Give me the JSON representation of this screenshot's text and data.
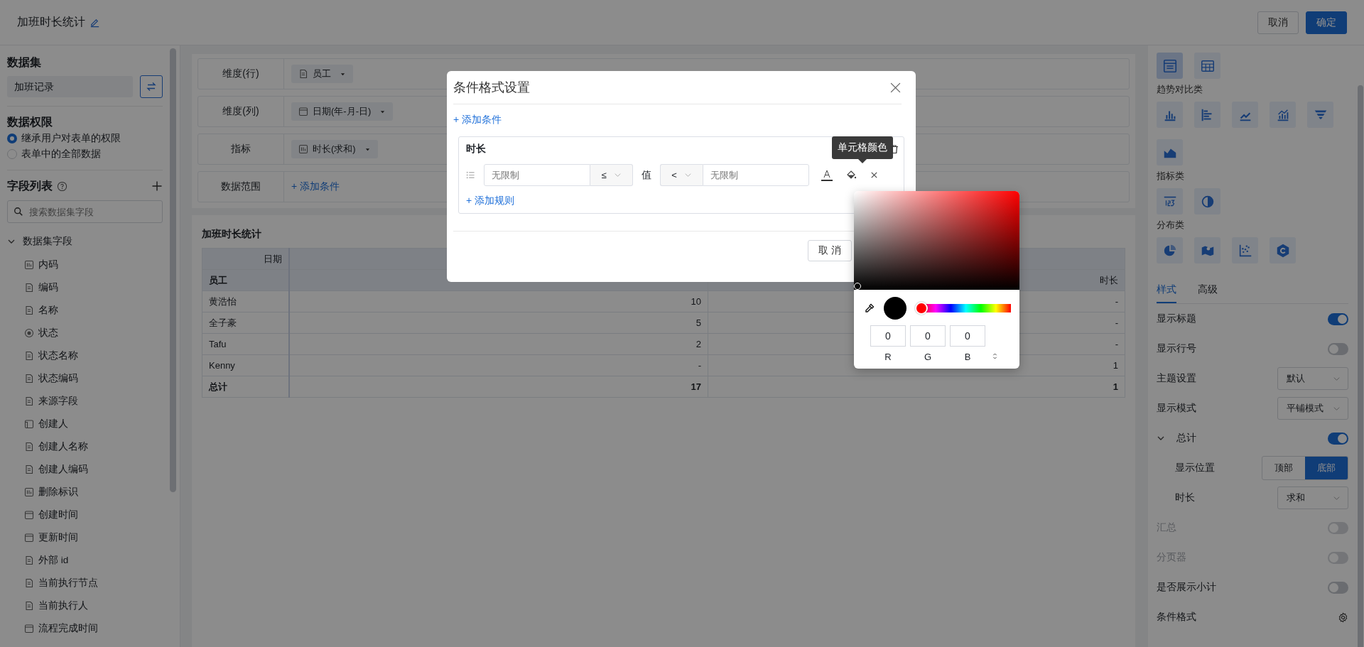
{
  "header": {
    "title": "加班时长统计",
    "buttons": [
      {
        "label": "取消",
        "kind": "default"
      },
      {
        "label": "确定",
        "kind": "primary"
      }
    ]
  },
  "sidebar": {
    "dataset_heading": "数据集",
    "dataset": "加班记录",
    "permission_heading": "数据权限",
    "permissions": [
      {
        "label": "继承用户对表单的权限",
        "selected": true
      },
      {
        "label": "表单中的全部数据",
        "selected": false
      }
    ],
    "fields_heading": "字段列表",
    "search": {
      "placeholder": "搜索数据集字段"
    },
    "tree": {
      "label": "数据集字段",
      "expanded": true,
      "children": [
        {
          "label": "内码",
          "kind": "number"
        },
        {
          "label": "编码",
          "kind": "text"
        },
        {
          "label": "名称",
          "kind": "text"
        },
        {
          "label": "状态",
          "kind": "option"
        },
        {
          "label": "状态名称",
          "kind": "text"
        },
        {
          "label": "状态编码",
          "kind": "text"
        },
        {
          "label": "来源字段",
          "kind": "text"
        },
        {
          "label": "创建人",
          "kind": "member"
        },
        {
          "label": "创建人名称",
          "kind": "text"
        },
        {
          "label": "创建人编码",
          "kind": "text"
        },
        {
          "label": "删除标识",
          "kind": "number"
        },
        {
          "label": "创建时间",
          "kind": "date"
        },
        {
          "label": "更新时间",
          "kind": "date"
        },
        {
          "label": "外部 id",
          "kind": "text"
        },
        {
          "label": "当前执行节点",
          "kind": "text"
        },
        {
          "label": "当前执行人",
          "kind": "text"
        },
        {
          "label": "流程完成时间",
          "kind": "date"
        }
      ]
    }
  },
  "config": [
    {
      "label": "维度(行)",
      "chip": {
        "kind": "text",
        "text": "员工"
      }
    },
    {
      "label": "维度(列)",
      "chip": {
        "kind": "date",
        "text": "日期(年-月-日)"
      }
    },
    {
      "label": "指标",
      "chip": {
        "kind": "number",
        "text": "时长(求和)"
      }
    },
    {
      "label": "数据范围",
      "link": "+ 添加条件"
    }
  ],
  "table": {
    "title": "加班时长统计",
    "corner_top": "日期",
    "corner_bottom": "员工",
    "value_header": "时长",
    "rows": [
      {
        "name": "黄浩怡",
        "cells": [
          "10",
          "-"
        ]
      },
      {
        "name": "全子豪",
        "cells": [
          "5",
          "-"
        ]
      },
      {
        "name": "Tafu",
        "cells": [
          "2",
          "-"
        ]
      },
      {
        "name": "Kenny",
        "cells": [
          "-",
          "1"
        ]
      }
    ],
    "total": {
      "name": "总计",
      "cells": [
        "17",
        "1"
      ]
    }
  },
  "chart_types": [
    {
      "items": [
        {
          "kind": "table",
          "selected": true
        },
        {
          "kind": "pivot",
          "selected": false
        }
      ]
    },
    {
      "title": "趋势对比类",
      "items": [
        {
          "kind": "bar",
          "selected": false
        },
        {
          "kind": "hbar",
          "selected": false
        },
        {
          "kind": "line",
          "selected": false
        },
        {
          "kind": "combo",
          "selected": false
        },
        {
          "kind": "funnel",
          "selected": false
        },
        {
          "kind": "area",
          "selected": false
        }
      ]
    },
    {
      "title": "指标类",
      "items": [
        {
          "kind": "kpi",
          "selected": false
        },
        {
          "kind": "gauge",
          "selected": false
        }
      ]
    },
    {
      "title": "分布类",
      "items": [
        {
          "kind": "pie",
          "selected": false
        },
        {
          "kind": "map",
          "selected": false
        },
        {
          "kind": "scatter",
          "selected": false
        },
        {
          "kind": "hexagon",
          "selected": false
        }
      ]
    }
  ],
  "panel_tabs": [
    {
      "label": "样式",
      "selected": true
    },
    {
      "label": "高级",
      "selected": false
    }
  ],
  "settings": [
    {
      "kind": "toggle",
      "label": "显示标题",
      "on": true,
      "disabled": false
    },
    {
      "kind": "toggle",
      "label": "显示行号",
      "on": false,
      "disabled": false
    },
    {
      "kind": "select",
      "label": "主题设置",
      "value": "默认"
    },
    {
      "kind": "select",
      "label": "显示模式",
      "value": "平铺模式"
    },
    {
      "kind": "group",
      "label": "总计",
      "expanded": true,
      "on": true,
      "children": [
        {
          "kind": "segmented",
          "label": "显示位置",
          "options": [
            {
              "label": "顶部",
              "selected": false
            },
            {
              "label": "底部",
              "selected": true
            }
          ]
        },
        {
          "kind": "select",
          "label": "时长",
          "value": "求和"
        }
      ]
    },
    {
      "kind": "toggle",
      "label": "汇总",
      "on": false,
      "disabled": true
    },
    {
      "kind": "toggle",
      "label": "分页器",
      "on": false,
      "disabled": true
    },
    {
      "kind": "toggle",
      "label": "是否展示小计",
      "on": false,
      "disabled": false
    },
    {
      "kind": "gear",
      "label": "条件格式"
    }
  ],
  "dialog": {
    "title": "条件格式设置",
    "add_condition": "+ 添加条件",
    "conditions": [
      {
        "field": "时长",
        "rules": [
          {
            "min_placeholder": "无限制",
            "min_op": "≤",
            "value_label": "值",
            "max_op": "<",
            "max_placeholder": "无限制"
          }
        ],
        "add_rule": "+ 添加规则"
      }
    ],
    "tooltip": "单元格颜色",
    "buttons": [
      "取 消"
    ]
  },
  "color_picker": {
    "hue": {
      "level": 0
    },
    "channels": [
      {
        "label": "R",
        "value": "0"
      },
      {
        "label": "G",
        "value": "0"
      },
      {
        "label": "B",
        "value": "0"
      }
    ]
  }
}
